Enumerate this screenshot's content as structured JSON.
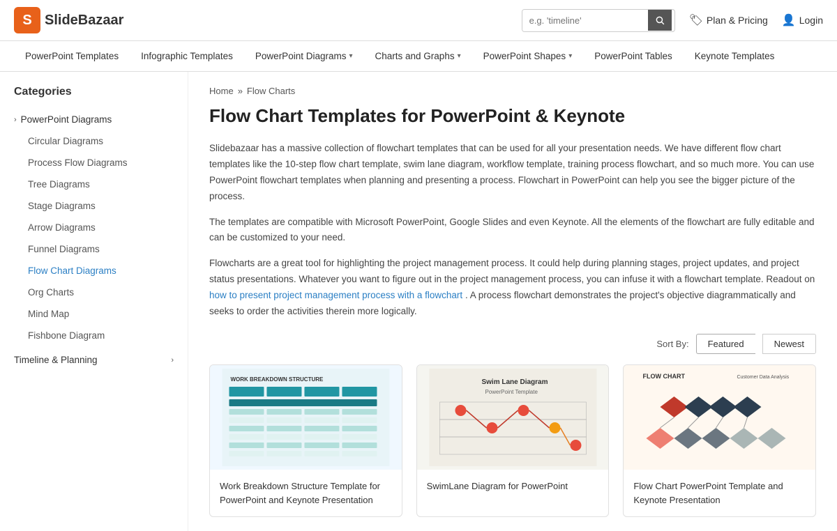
{
  "site": {
    "name": "SlideBazaar",
    "logo_letter": "S"
  },
  "header": {
    "search_placeholder": "e.g. 'timeline'",
    "plan_pricing_label": "Plan & Pricing",
    "login_label": "Login"
  },
  "navbar": {
    "items": [
      {
        "label": "PowerPoint Templates",
        "has_dropdown": false
      },
      {
        "label": "Infographic Templates",
        "has_dropdown": false
      },
      {
        "label": "PowerPoint Diagrams",
        "has_dropdown": true
      },
      {
        "label": "Charts and Graphs",
        "has_dropdown": true
      },
      {
        "label": "PowerPoint Shapes",
        "has_dropdown": true
      },
      {
        "label": "PowerPoint Tables",
        "has_dropdown": false
      },
      {
        "label": "Keynote Templates",
        "has_dropdown": false
      }
    ]
  },
  "sidebar": {
    "title": "Categories",
    "sections": [
      {
        "label": "PowerPoint Diagrams",
        "expanded": true,
        "subitems": [
          {
            "label": "Circular Diagrams",
            "active": false
          },
          {
            "label": "Process Flow Diagrams",
            "active": false
          },
          {
            "label": "Tree Diagrams",
            "active": false
          },
          {
            "label": "Stage Diagrams",
            "active": false
          },
          {
            "label": "Arrow Diagrams",
            "active": false
          },
          {
            "label": "Funnel Diagrams",
            "active": false
          },
          {
            "label": "Flow Chart Diagrams",
            "active": true
          },
          {
            "label": "Org Charts",
            "active": false
          },
          {
            "label": "Mind Map",
            "active": false
          },
          {
            "label": "Fishbone Diagram",
            "active": false
          }
        ]
      }
    ],
    "bottom_items": [
      {
        "label": "Timeline & Planning",
        "has_arrow": true
      }
    ]
  },
  "breadcrumb": {
    "home_label": "Home",
    "separator": "»",
    "current": "Flow Charts"
  },
  "page": {
    "title": "Flow Chart Templates for PowerPoint & Keynote",
    "description_1": "Slidebazaar has a massive collection of flowchart templates that can be used for all your presentation needs. We have different flow chart templates like the 10-step flow chart template, swim lane diagram, workflow template, training process flowchart, and so much more. You can use PowerPoint flowchart templates when planning and presenting a process. Flowchart in PowerPoint can help you see the bigger picture of the process.",
    "description_2": "The templates are compatible with Microsoft PowerPoint, Google Slides and even Keynote. All the elements of the flowchart are fully editable and can be customized to your need.",
    "description_3_pre": "Flowcharts are a great tool for highlighting the project management process. It could help during planning stages, project updates, and project status presentations. Whatever you want to figure out in the project management process, you can infuse it with a flowchart template. Readout on",
    "description_3_link": "how to present project management process with a flowchart",
    "description_3_post": ". A process flowchart demonstrates the project's objective diagrammatically and seeks to order the activities therein more logically."
  },
  "sort": {
    "label": "Sort By:",
    "options": [
      {
        "label": "Featured",
        "active": true
      },
      {
        "label": "Newest",
        "active": false
      }
    ]
  },
  "cards": [
    {
      "id": 1,
      "title": "Work Breakdown Structure Template for PowerPoint and Keynote Presentation",
      "img_type": "wbs"
    },
    {
      "id": 2,
      "title": "SwimLane Diagram for PowerPoint",
      "img_type": "swimlane"
    },
    {
      "id": 3,
      "title": "Flow Chart PowerPoint Template and Keynote Presentation",
      "img_type": "flowchart"
    }
  ]
}
